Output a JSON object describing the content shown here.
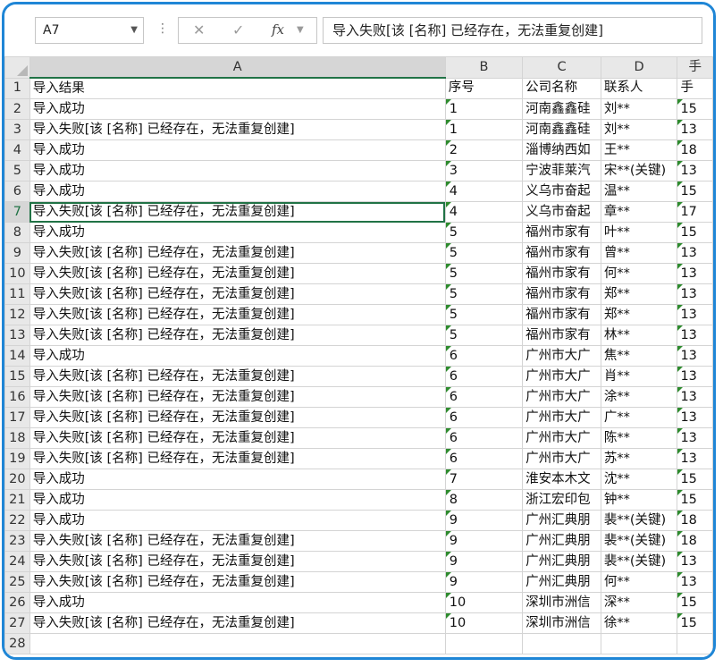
{
  "formula_bar": {
    "name_box": "A7",
    "cancel_icon": "✕",
    "confirm_icon": "✓",
    "fx_label": "fx",
    "formula": "导入失败[该 [名称] 已经存在，无法重复创建]"
  },
  "columns": [
    "A",
    "B",
    "C",
    "D",
    "手"
  ],
  "rows": [
    {
      "n": "1",
      "a": "导入结果",
      "b": "序号",
      "c": "公司名称",
      "d": "联系人",
      "e": "手"
    },
    {
      "n": "2",
      "a": "导入成功",
      "b": "1",
      "c": "河南鑫鑫硅",
      "d": "刘**",
      "e": "15"
    },
    {
      "n": "3",
      "a": "导入失败[该 [名称] 已经存在，无法重复创建]",
      "b": "1",
      "c": "河南鑫鑫硅",
      "d": "刘**",
      "e": "13"
    },
    {
      "n": "4",
      "a": "导入成功",
      "b": "2",
      "c": "淄博纳西如",
      "d": "王**",
      "e": "18"
    },
    {
      "n": "5",
      "a": "导入成功",
      "b": "3",
      "c": "宁波菲莱汽",
      "d": "宋**(关键)",
      "e": "13"
    },
    {
      "n": "6",
      "a": "导入成功",
      "b": "4",
      "c": "义乌市奋起",
      "d": "温**",
      "e": "15"
    },
    {
      "n": "7",
      "a": "导入失败[该 [名称] 已经存在，无法重复创建]",
      "b": "4",
      "c": "义乌市奋起",
      "d": "章**",
      "e": "17"
    },
    {
      "n": "8",
      "a": "导入成功",
      "b": "5",
      "c": "福州市家有",
      "d": "叶**",
      "e": "15"
    },
    {
      "n": "9",
      "a": "导入失败[该 [名称] 已经存在，无法重复创建]",
      "b": "5",
      "c": "福州市家有",
      "d": "曾**",
      "e": "13"
    },
    {
      "n": "10",
      "a": "导入失败[该 [名称] 已经存在，无法重复创建]",
      "b": "5",
      "c": "福州市家有",
      "d": "何**",
      "e": "13"
    },
    {
      "n": "11",
      "a": "导入失败[该 [名称] 已经存在，无法重复创建]",
      "b": "5",
      "c": "福州市家有",
      "d": "郑**",
      "e": "13"
    },
    {
      "n": "12",
      "a": "导入失败[该 [名称] 已经存在，无法重复创建]",
      "b": "5",
      "c": "福州市家有",
      "d": "郑**",
      "e": "13"
    },
    {
      "n": "13",
      "a": "导入失败[该 [名称] 已经存在，无法重复创建]",
      "b": "5",
      "c": "福州市家有",
      "d": "林**",
      "e": "13"
    },
    {
      "n": "14",
      "a": "导入成功",
      "b": "6",
      "c": "广州市大广",
      "d": "焦**",
      "e": "13"
    },
    {
      "n": "15",
      "a": "导入失败[该 [名称] 已经存在，无法重复创建]",
      "b": "6",
      "c": "广州市大广",
      "d": "肖**",
      "e": "13"
    },
    {
      "n": "16",
      "a": "导入失败[该 [名称] 已经存在，无法重复创建]",
      "b": "6",
      "c": "广州市大广",
      "d": "涂**",
      "e": "13"
    },
    {
      "n": "17",
      "a": "导入失败[该 [名称] 已经存在，无法重复创建]",
      "b": "6",
      "c": "广州市大广",
      "d": "广**",
      "e": "13"
    },
    {
      "n": "18",
      "a": "导入失败[该 [名称] 已经存在，无法重复创建]",
      "b": "6",
      "c": "广州市大广",
      "d": "陈**",
      "e": "13"
    },
    {
      "n": "19",
      "a": "导入失败[该 [名称] 已经存在，无法重复创建]",
      "b": "6",
      "c": "广州市大广",
      "d": "苏**",
      "e": "13"
    },
    {
      "n": "20",
      "a": "导入成功",
      "b": "7",
      "c": "淮安本木文",
      "d": "沈**",
      "e": "15"
    },
    {
      "n": "21",
      "a": "导入成功",
      "b": "8",
      "c": "浙江宏印包",
      "d": "钟**",
      "e": "15"
    },
    {
      "n": "22",
      "a": "导入成功",
      "b": "9",
      "c": "广州汇典朋",
      "d": "裴**(关键)",
      "e": "18"
    },
    {
      "n": "23",
      "a": "导入失败[该 [名称] 已经存在，无法重复创建]",
      "b": "9",
      "c": "广州汇典朋",
      "d": "裴**(关键)",
      "e": "18"
    },
    {
      "n": "24",
      "a": "导入失败[该 [名称] 已经存在，无法重复创建]",
      "b": "9",
      "c": "广州汇典朋",
      "d": "裴**(关键)",
      "e": "13"
    },
    {
      "n": "25",
      "a": "导入失败[该 [名称] 已经存在，无法重复创建]",
      "b": "9",
      "c": "广州汇典朋",
      "d": "何**",
      "e": "13"
    },
    {
      "n": "26",
      "a": "导入成功",
      "b": "10",
      "c": "深圳市洲信",
      "d": "深**",
      "e": "15"
    },
    {
      "n": "27",
      "a": "导入失败[该 [名称] 已经存在，无法重复创建]",
      "b": "10",
      "c": "深圳市洲信",
      "d": "徐**",
      "e": "15"
    },
    {
      "n": "28",
      "a": "",
      "b": "",
      "c": "",
      "d": "",
      "e": ""
    }
  ]
}
